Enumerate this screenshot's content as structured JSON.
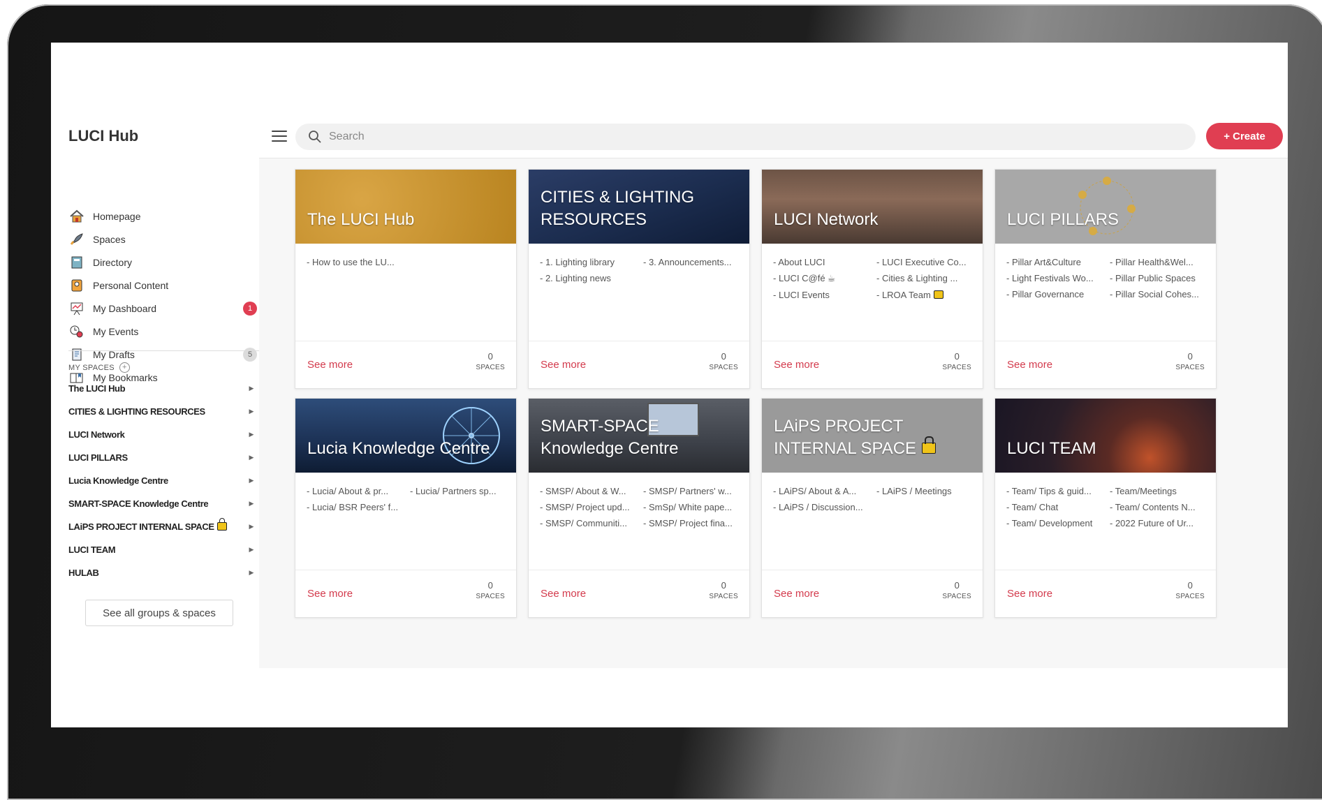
{
  "app": {
    "title": "LUCI Hub"
  },
  "sidebar": {
    "nav": [
      {
        "label": "Homepage",
        "icon": "house-icon"
      },
      {
        "label": "Spaces",
        "icon": "rocket-icon"
      },
      {
        "label": "Directory",
        "icon": "directory-icon"
      },
      {
        "label": "Personal Content",
        "icon": "personal-content-icon"
      },
      {
        "label": "My Dashboard",
        "icon": "dashboard-icon",
        "badge": "1"
      },
      {
        "label": "My Events",
        "icon": "events-icon"
      },
      {
        "label": "My Drafts",
        "icon": "drafts-icon",
        "badge": "5"
      },
      {
        "label": "My Bookmarks",
        "icon": "bookmarks-icon"
      }
    ],
    "my_spaces_label": "MY SPACES",
    "spaces": [
      "The LUCI Hub",
      "CITIES & LIGHTING RESOURCES",
      "LUCI Network",
      "LUCI PILLARS",
      "Lucia Knowledge Centre",
      "SMART-SPACE Knowledge Centre",
      "LAiPS PROJECT INTERNAL SPACE",
      "LUCI TEAM",
      "HULAB"
    ],
    "see_all_label": "See all groups & spaces"
  },
  "topbar": {
    "search_placeholder": "Search",
    "create_label": "+ Create"
  },
  "cards": [
    {
      "title": "The LUCI Hub",
      "links": [
        "- How to use the LU..."
      ],
      "see_more": "See more",
      "count": "0",
      "count_label": "SPACES"
    },
    {
      "title": "CITIES & LIGHTING RESOURCES",
      "links": [
        "- 1. Lighting library",
        "- 3. Announcements...",
        "- 2. Lighting news"
      ],
      "see_more": "See more",
      "count": "0",
      "count_label": "SPACES"
    },
    {
      "title": "LUCI Network",
      "links": [
        "- About LUCI",
        "- LUCI Executive Co...",
        "- LUCI C@fé",
        "- Cities & Lighting ...",
        "- LUCI Events",
        "- LROA Team"
      ],
      "see_more": "See more",
      "count": "0",
      "count_label": "SPACES"
    },
    {
      "title": "LUCI PILLARS",
      "links": [
        "- Pillar Art&Culture",
        "- Pillar Health&Wel...",
        "- Light Festivals Wo...",
        "- Pillar Public Spaces",
        "- Pillar Governance",
        "- Pillar Social Cohes..."
      ],
      "see_more": "See more",
      "count": "0",
      "count_label": "SPACES"
    },
    {
      "title": "Lucia Knowledge Centre",
      "links": [
        "- Lucia/ About & pr...",
        "- Lucia/ Partners sp...",
        "- Lucia/ BSR Peers' f..."
      ],
      "see_more": "See more",
      "count": "0",
      "count_label": "SPACES"
    },
    {
      "title": "SMART-SPACE Knowledge Centre",
      "links": [
        "- SMSP/ About & W...",
        "- SMSP/ Partners' w...",
        "- SMSP/ Project upd...",
        "- SmSp/ White pape...",
        "- SMSP/ Communiti...",
        "- SMSP/ Project fina..."
      ],
      "see_more": "See more",
      "count": "0",
      "count_label": "SPACES"
    },
    {
      "title": "LAiPS PROJECT INTERNAL SPACE",
      "links": [
        "- LAiPS/ About & A...",
        "- LAiPS / Meetings",
        "- LAiPS / Discussion..."
      ],
      "see_more": "See more",
      "count": "0",
      "count_label": "SPACES"
    },
    {
      "title": "LUCI TEAM",
      "links": [
        "- Team/ Tips & guid...",
        "- Team/Meetings",
        "- Team/ Chat",
        "- Team/ Contents N...",
        "- Team/ Development",
        "- 2022 Future of Ur..."
      ],
      "see_more": "See more",
      "count": "0",
      "count_label": "SPACES"
    }
  ],
  "colors": {
    "accent": "#e03e52",
    "link": "#d33a4c",
    "card_gold": "#c8922a",
    "card_navy": "#1b2c4e",
    "card_grey": "#9a9a9a"
  }
}
